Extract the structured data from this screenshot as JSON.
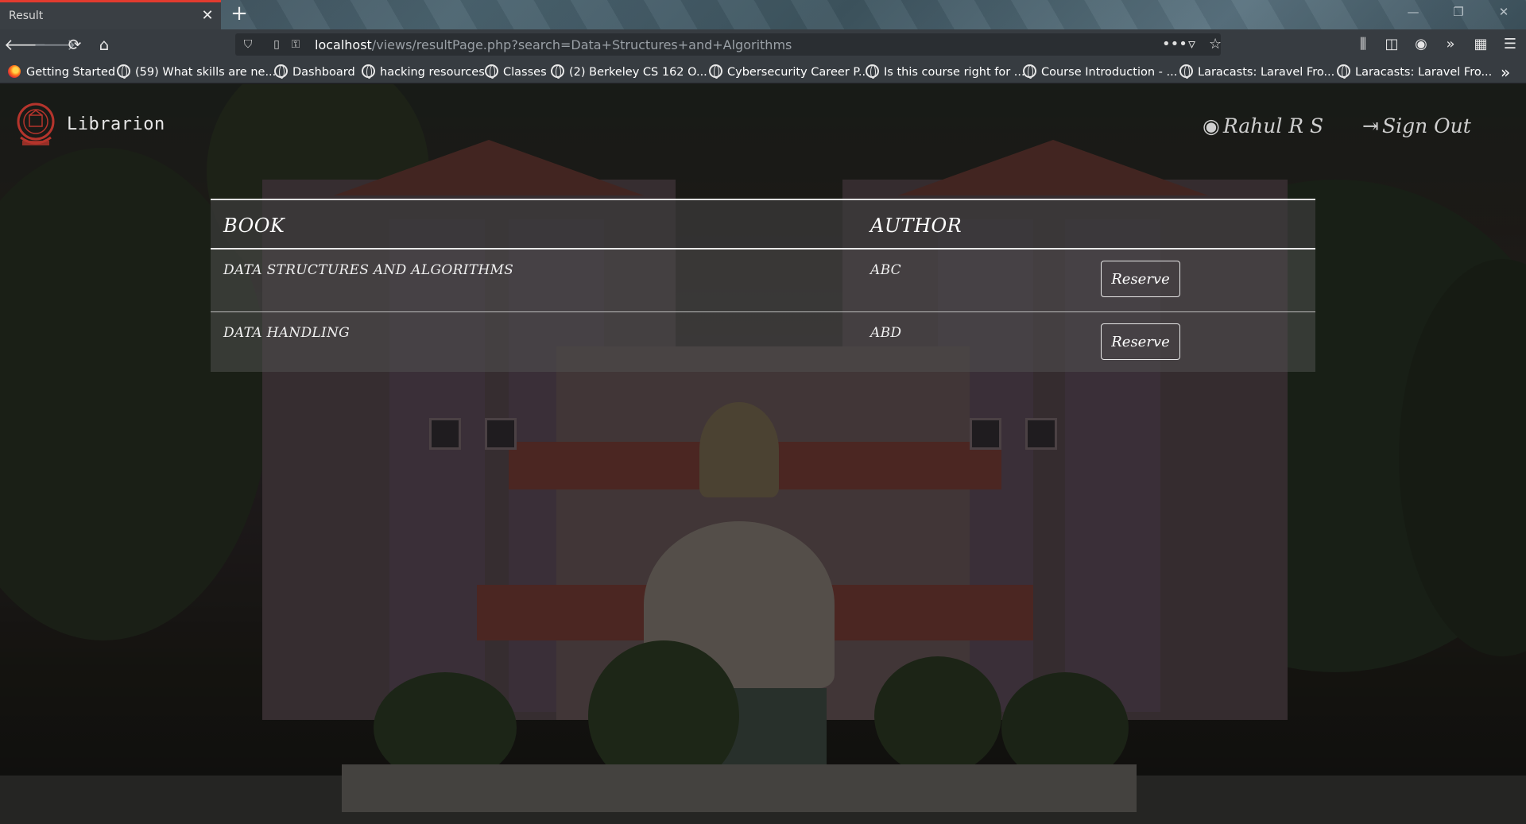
{
  "browser": {
    "tab_title": "Result",
    "tab_close_icon": "close-icon",
    "new_tab_icon": "plus-icon",
    "url_host": "localhost",
    "url_path": "/views/resultPage.php?search=Data+Structures+and+Algorithms",
    "bookmarks": [
      "Getting Started",
      "(59) What skills are ne...",
      "Dashboard",
      "hacking resources",
      "Classes",
      "(2) Berkeley CS 162 O...",
      "Cybersecurity Career P...",
      "Is this course right for ...",
      "Course Introduction - ...",
      "Laracasts: Laravel Fro...",
      "Laracasts: Laravel Fro..."
    ]
  },
  "app": {
    "brand": "Librarion",
    "user": "Rahul R S",
    "signout": "Sign Out"
  },
  "table": {
    "headers": [
      "BOOK",
      "AUTHOR"
    ],
    "rows": [
      {
        "book": "DATA STRUCTURES AND ALGORITHMS",
        "author": "ABC",
        "action": "Reserve"
      },
      {
        "book": "DATA HANDLING",
        "author": "ABD",
        "action": "Reserve"
      }
    ]
  }
}
